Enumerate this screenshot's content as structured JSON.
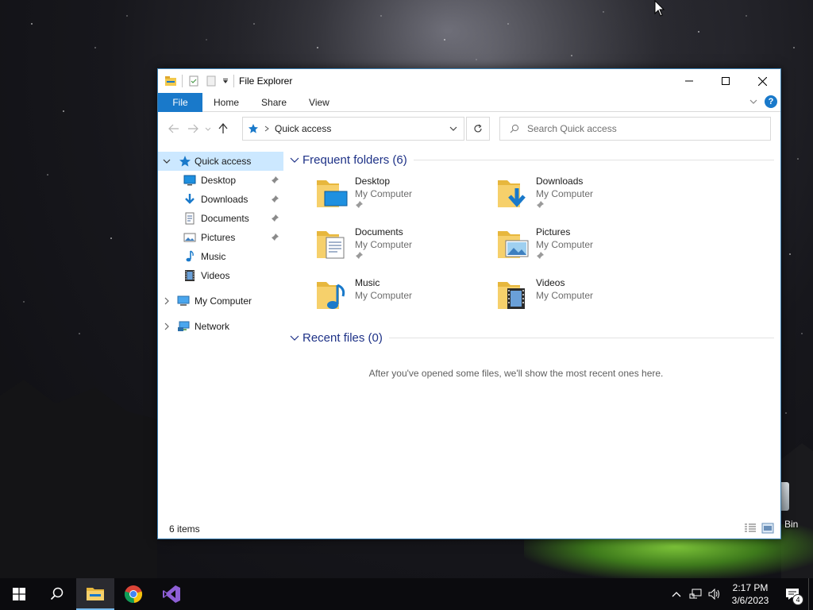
{
  "desktop": {
    "recycle_bin_label": "Bin"
  },
  "window": {
    "title": "File Explorer",
    "controls": [
      "minimize-icon",
      "maximize-icon",
      "close-icon"
    ]
  },
  "ribbon": {
    "tabs": [
      "File",
      "Home",
      "Share",
      "View"
    ]
  },
  "navbar": {
    "address_crumb": "Quick access",
    "search_placeholder": "Search Quick access"
  },
  "nav_pane": {
    "quick_access": "Quick access",
    "items": [
      {
        "label": "Desktop",
        "icon": "desktop-icon",
        "pinned": true
      },
      {
        "label": "Downloads",
        "icon": "downloads-icon",
        "pinned": true
      },
      {
        "label": "Documents",
        "icon": "documents-icon",
        "pinned": true
      },
      {
        "label": "Pictures",
        "icon": "pictures-icon",
        "pinned": true
      },
      {
        "label": "Music",
        "icon": "music-icon",
        "pinned": false
      },
      {
        "label": "Videos",
        "icon": "videos-icon",
        "pinned": false
      }
    ],
    "my_computer": "My Computer",
    "network": "Network"
  },
  "content": {
    "frequent_header": "Frequent folders (6)",
    "folders": [
      {
        "name": "Desktop",
        "location": "My Computer",
        "pinned": true
      },
      {
        "name": "Downloads",
        "location": "My Computer",
        "pinned": true
      },
      {
        "name": "Documents",
        "location": "My Computer",
        "pinned": true
      },
      {
        "name": "Pictures",
        "location": "My Computer",
        "pinned": true
      },
      {
        "name": "Music",
        "location": "My Computer",
        "pinned": false
      },
      {
        "name": "Videos",
        "location": "My Computer",
        "pinned": false
      }
    ],
    "recent_header": "Recent files (0)",
    "recent_empty": "After you've opened some files, we'll show the most recent ones here."
  },
  "status": {
    "item_count": "6 items"
  },
  "taskbar": {
    "time": "2:17 PM",
    "date": "3/6/2023",
    "notification_count": "4"
  },
  "colors": {
    "accent": "#1979ca",
    "selection": "#cce8ff",
    "group_header": "#1e3287",
    "folder_yellow": "#f2c94c"
  }
}
